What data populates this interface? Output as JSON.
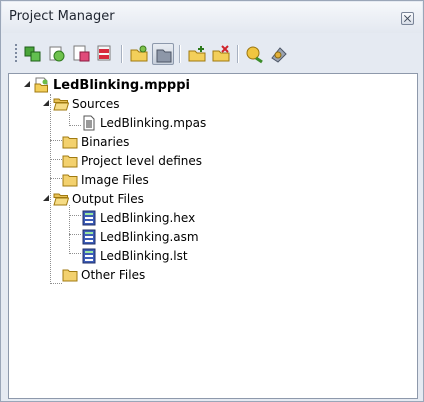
{
  "panel": {
    "title": "Project Manager"
  },
  "toolbar": {
    "buttons": [
      "build-all-icon",
      "build-icon",
      "add-module-icon",
      "remove-module-icon",
      "new-project-icon",
      "close-project-icon",
      "add-file-icon",
      "remove-file-icon",
      "edit-icon",
      "programmer-icon"
    ]
  },
  "tree": {
    "project": "LedBlinking.mpppi",
    "folders": {
      "sources": "Sources",
      "binaries": "Binaries",
      "defines": "Project level defines",
      "images": "Image Files",
      "output": "Output Files",
      "other": "Other Files"
    },
    "files": {
      "mpas": "LedBlinking.mpas",
      "hex": "LedBlinking.hex",
      "asm": "LedBlinking.asm",
      "lst": "LedBlinking.lst"
    }
  }
}
